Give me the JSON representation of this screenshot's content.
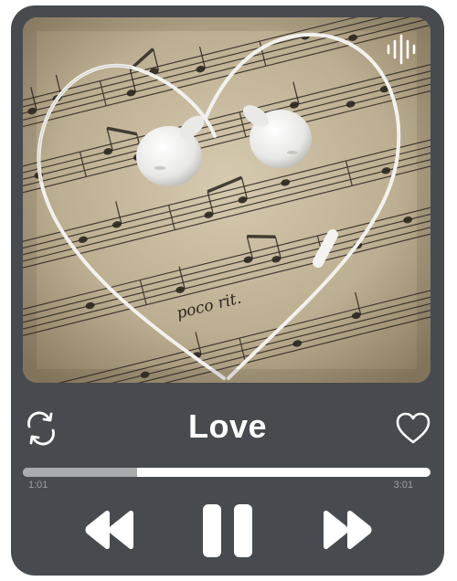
{
  "track": {
    "title": "Love",
    "current_time": "1:01",
    "total_time": "3:01",
    "progress": 0.28
  },
  "icons": {
    "cover_badge": "sound-wave-icon",
    "repeat": "repeat-icon",
    "favorite": "heart-outline-icon",
    "rewind": "rewind-icon",
    "pause": "pause-icon",
    "forward": "fast-forward-icon"
  },
  "cover": {
    "text": "poco rit."
  },
  "colors": {
    "panel": "#474b50",
    "progress_track": "#ffffff",
    "progress_fill": "#a9acaf",
    "text": "#ffffff"
  }
}
